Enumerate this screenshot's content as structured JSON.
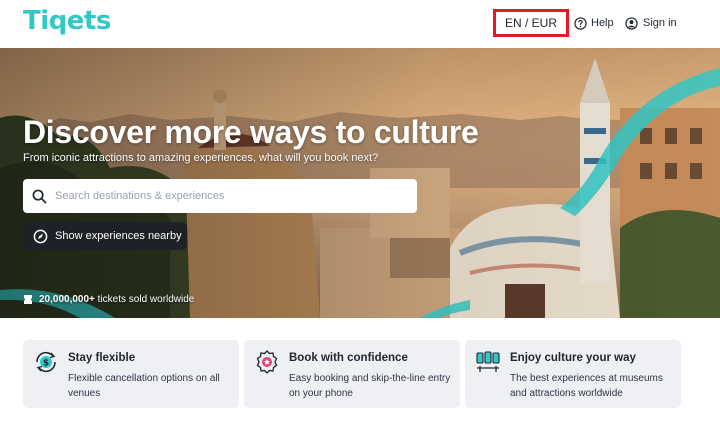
{
  "header": {
    "logo_text": "Tiqets",
    "language_currency": "EN / EUR",
    "help_label": "Help",
    "signin_label": "Sign in"
  },
  "hero": {
    "title": "Discover more ways to culture",
    "subtitle": "From iconic attractions to amazing experiences, what will you book next?",
    "search_placeholder": "Search destinations & experiences",
    "nearby_button": "Show experiences nearby",
    "tickets_sold_count": "20,000,000+",
    "tickets_sold_suffix": " tickets sold worldwide"
  },
  "features": [
    {
      "icon": "dollar-refresh-icon",
      "title": "Stay flexible",
      "description": "Flexible cancellation options on all venues"
    },
    {
      "icon": "award-badge-icon",
      "title": "Book with confidence",
      "description": "Easy booking and skip-the-line entry on your phone"
    },
    {
      "icon": "museum-exhibits-icon",
      "title": "Enjoy culture your way",
      "description": "The best experiences at museums and attractions worldwide"
    }
  ],
  "colors": {
    "brand_teal": "#33c7c5",
    "highlight_red": "#e21b23",
    "dark_button": "#1e2128",
    "card_bg": "#eef0f4"
  }
}
